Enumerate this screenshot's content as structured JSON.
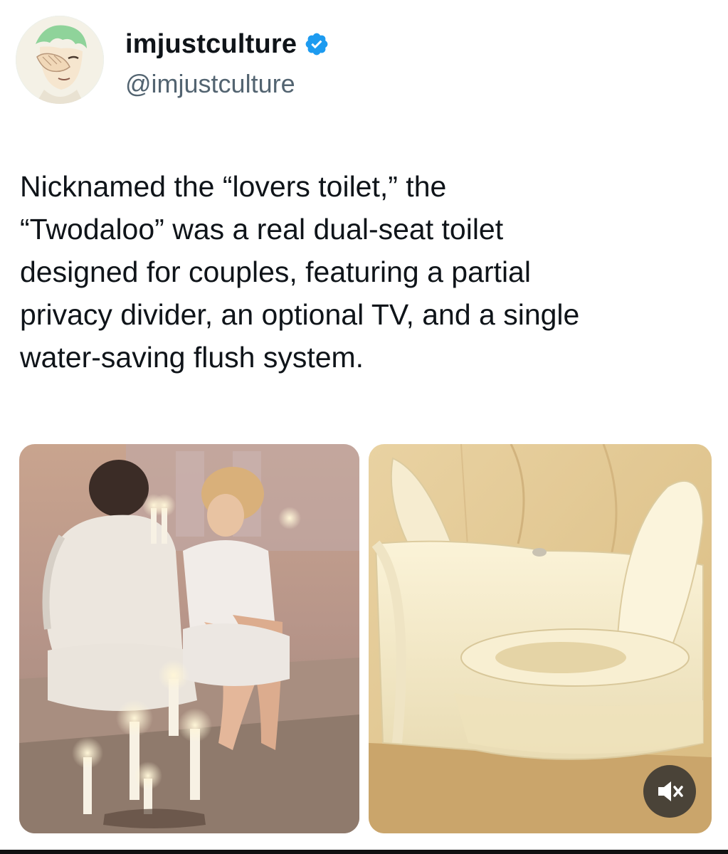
{
  "post": {
    "author": {
      "display_name": "imjustculture",
      "handle": "@imjustculture",
      "verified": true,
      "verified_color": "#1d9bf0",
      "avatar_icon": "avatar-anime-character"
    },
    "text": "Nicknamed the “lovers toilet,” the\n“Twodaloo” was a real dual-seat toilet\ndesigned for couples, featuring a partial\nprivacy divider, an optional TV, and a single\nwater-saving flush system.",
    "media": [
      {
        "kind": "image",
        "description_icon": "photo"
      },
      {
        "kind": "video",
        "description_icon": "photo",
        "control": "mute-icon"
      }
    ]
  }
}
